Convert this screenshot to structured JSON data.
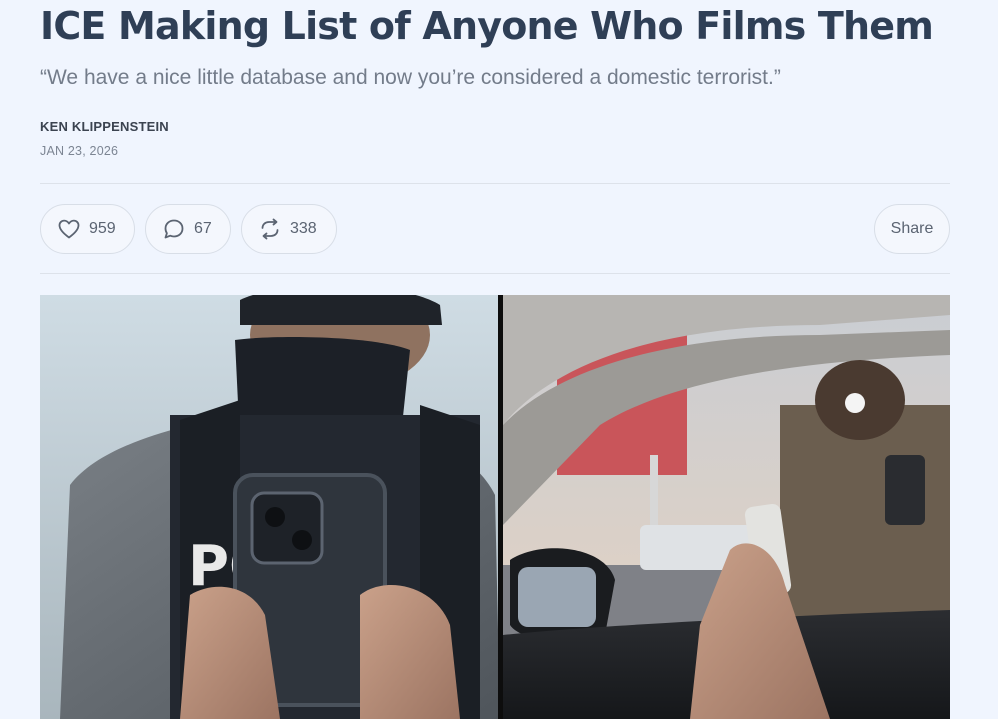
{
  "article": {
    "title": "ICE Making List of Anyone Who Films Them",
    "subtitle": "“We have a nice little database and now you’re considered a domestic terrorist.”",
    "author": "KEN KLIPPENSTEIN",
    "date": "JAN 23, 2026"
  },
  "actions": {
    "likes": "959",
    "comments": "67",
    "restacks": "338",
    "share_label": "Share"
  },
  "media": {
    "vest_text": "PO"
  },
  "icons": {
    "like": "heart-icon",
    "comment": "speech-bubble-icon",
    "restack": "restack-arrows-icon"
  },
  "colors": {
    "background": "#f0f5fe",
    "title": "#2f3f56",
    "muted": "#737c8a",
    "border": "#d8dee7"
  }
}
